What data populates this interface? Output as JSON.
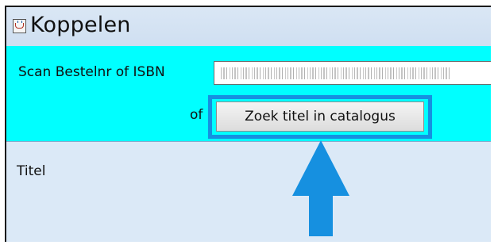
{
  "window": {
    "title": "Koppelen",
    "icon": "java-cup-icon"
  },
  "scan_panel": {
    "scan_label": "Scan Bestelnr of ISBN",
    "barcode_input_value": "",
    "barcode_image": "barcode-icon",
    "of_label": "of",
    "search_button_label": "Zoek titel in catalogus",
    "background_color": "#00ffff"
  },
  "content": {
    "titel_label": "Titel"
  },
  "annotation": {
    "highlight_color": "#1690e0",
    "arrow_icon": "arrow-up-icon",
    "arrow_color": "#1690e0"
  }
}
